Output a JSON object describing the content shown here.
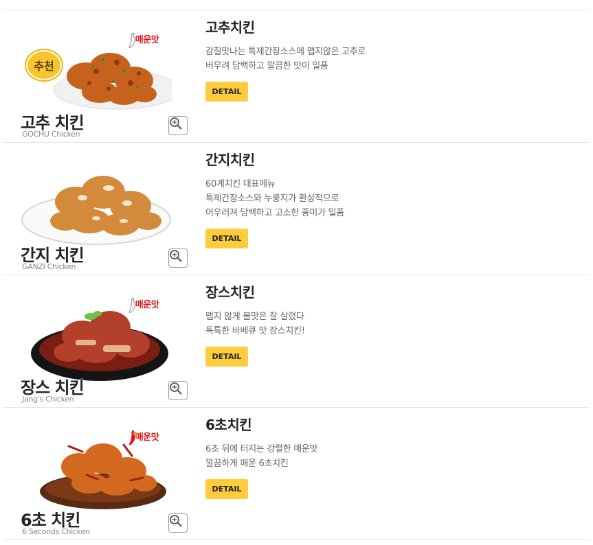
{
  "items": [
    {
      "title": "고추치킨",
      "desc": [
        "감칠맛나는 특제간장소스에 맵지않은 고추로",
        "버무려 담백하고 깔끔한 맛이 일품"
      ],
      "thumb_title": "고추 치킨",
      "thumb_sub": "GOCHU Chicken",
      "badge": "추천",
      "spicy_label": "매운맛",
      "spicy_level": 1,
      "detail_label": "DETAIL"
    },
    {
      "title": "간지치킨",
      "desc": [
        "60계치킨 대표메뉴",
        "특제간장소스와 누룽지가 환상적으로",
        "어우러져 담백하고 고소한 풍미가 일품"
      ],
      "thumb_title": "간지 치킨",
      "thumb_sub": "GANZI Chicken",
      "detail_label": "DETAIL"
    },
    {
      "title": "장스치킨",
      "desc": [
        "맵지 않게 불맛은 잘 살렸다",
        "독특한 바베큐 맛 장스치킨!"
      ],
      "thumb_title": "장스 치킨",
      "thumb_sub": "Jang's Chicken",
      "spicy_label": "매운맛",
      "spicy_level": 1,
      "detail_label": "DETAIL"
    },
    {
      "title": "6초치킨",
      "desc": [
        "6초 뒤에 터지는 강렬한 매운맛",
        "깔끔하게 매운 6초치킨"
      ],
      "thumb_title": "6초 치킨",
      "thumb_sub": "6 Seconds Chicken",
      "spicy_label": "매운맛",
      "spicy_level": 3,
      "detail_label": "DETAIL"
    }
  ],
  "colors": {
    "accent_button": "#fdcd3e",
    "spicy_red": "#e1141b",
    "divider": "#e3e3e3"
  }
}
